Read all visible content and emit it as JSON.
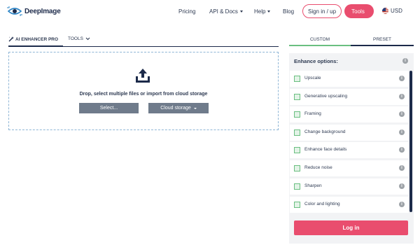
{
  "brand": {
    "name": "DeepImage",
    "accent_color": "#e94d6e",
    "dark_color": "#1c2a4a",
    "logo_icon": "eye-logo-icon"
  },
  "header": {
    "nav": [
      {
        "label": "Pricing",
        "has_dropdown": false
      },
      {
        "label": "API & Docs",
        "has_dropdown": true
      },
      {
        "label": "Help",
        "has_dropdown": true
      },
      {
        "label": "Blog",
        "has_dropdown": false
      }
    ],
    "signin_label": "Sign in / up",
    "tools_label": "Tools",
    "currency": "USD"
  },
  "left_tabs": {
    "enhancer_label": "AI ENHANCER PRO",
    "tools_label": "TOOLS"
  },
  "dropzone": {
    "icon": "upload-icon",
    "text": "Drop, select multiple files or import from cloud storage",
    "select_label": "Select...",
    "cloud_label": "Cloud storage"
  },
  "right_tabs": {
    "custom_label": "CUSTOM",
    "preset_label": "PRESET"
  },
  "panel": {
    "title": "Enhance options:",
    "options": [
      {
        "label": "Upscale"
      },
      {
        "label": "Generative upscaling"
      },
      {
        "label": "Framing"
      },
      {
        "label": "Change background"
      },
      {
        "label": "Enhance face details"
      },
      {
        "label": "Reduce noise"
      },
      {
        "label": "Sharpen"
      },
      {
        "label": "Color and lighting"
      }
    ],
    "login_label": "Log in"
  }
}
